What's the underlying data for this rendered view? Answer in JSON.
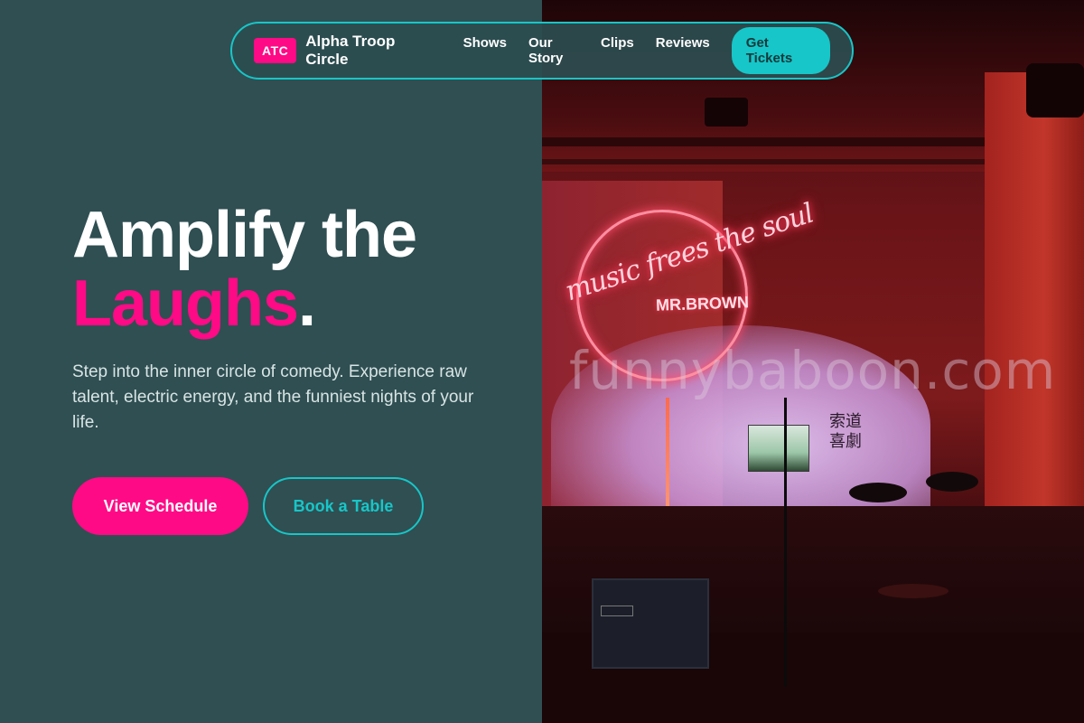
{
  "nav": {
    "brand_badge": "ATC",
    "brand_name": "Alpha Troop Circle",
    "links": [
      "Shows",
      "Our Story",
      "Clips",
      "Reviews"
    ],
    "cta": "Get Tickets"
  },
  "hero": {
    "title_line1": "Amplify the",
    "title_accent": "Laughs",
    "title_period": ".",
    "subtitle": "Step into the inner circle of comedy. Experience raw talent, electric energy, and the funniest nights of your life.",
    "primary_button": "View Schedule",
    "secondary_button": "Book a Table"
  },
  "image": {
    "neon_script": "music frees the soul",
    "neon_sub": "MR.BROWN",
    "sign_cjk": "索道喜劇",
    "watermark": "funnybaboon.com"
  },
  "colors": {
    "background": "#2f4f52",
    "accent_pink": "#ff0a86",
    "accent_teal": "#17c6c8"
  }
}
